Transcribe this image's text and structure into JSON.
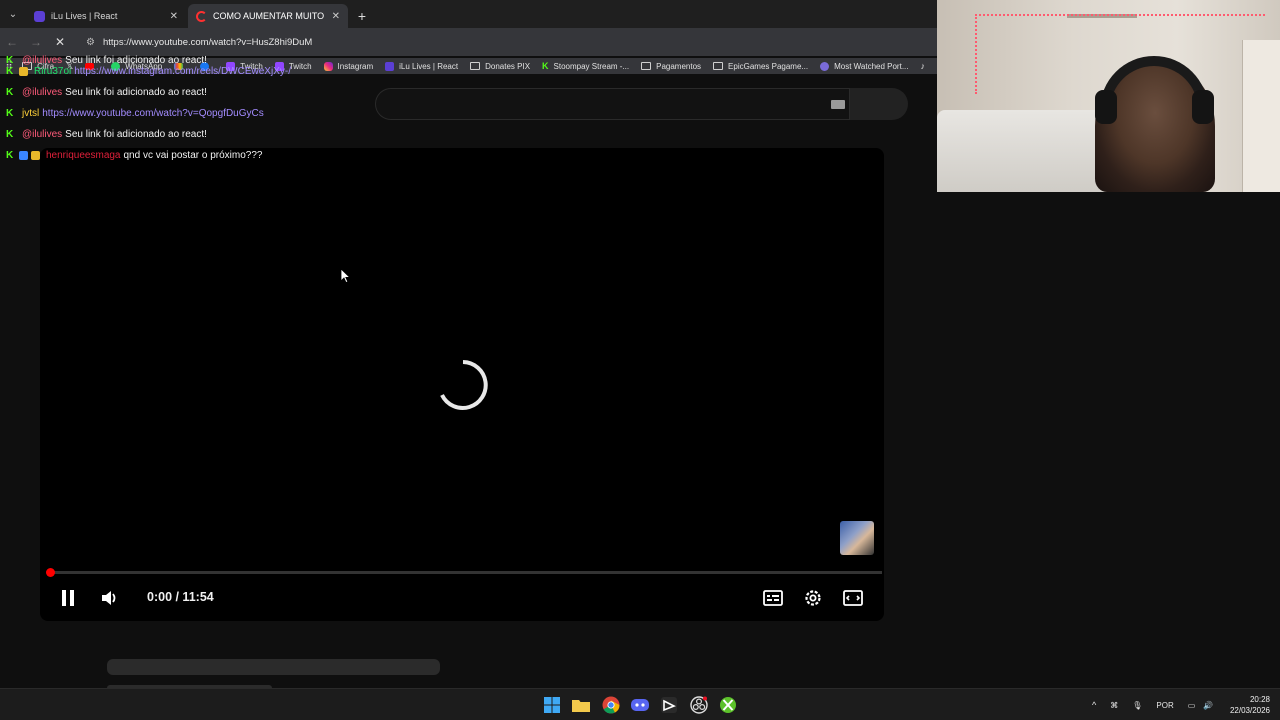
{
  "browser": {
    "tabs": [
      {
        "title": "iLu Lives | React",
        "close": "✕",
        "active": false,
        "favicon_color": "#5b3fd4"
      },
      {
        "title": "COMO AUMENTAR MUITO o FPS",
        "close": "✕",
        "active": true,
        "favicon_color": "#ff3030"
      }
    ],
    "new_tab": "+",
    "tab_menu": "⌄",
    "url": "https://www.youtube.com/watch?v=HusZ8hi9DuM",
    "bookmarks": [
      {
        "label": "Cifra",
        "icon": "folder-icon"
      },
      {
        "label": "",
        "icon": "x-icon"
      },
      {
        "label": "",
        "icon": "youtube-icon"
      },
      {
        "label": "WhatsApp",
        "icon": "whatsapp-icon"
      },
      {
        "label": "",
        "icon": "gmail-icon"
      },
      {
        "label": "",
        "icon": "facebook-icon"
      },
      {
        "label": "Twitch",
        "icon": "twitch-icon"
      },
      {
        "label": "Twitch",
        "icon": "twitch-icon"
      },
      {
        "label": "Instagram",
        "icon": "instagram-icon"
      },
      {
        "label": "iLu Lives | React",
        "icon": "ilu-icon"
      },
      {
        "label": "Donates PIX",
        "icon": "folder-icon"
      },
      {
        "label": "Stoompay Stream -...",
        "icon": "kick-icon"
      },
      {
        "label": "Pagamentos",
        "icon": "folder-icon"
      },
      {
        "label": "EpicGames Pagame...",
        "icon": "folder-icon"
      },
      {
        "label": "Most Watched Port...",
        "icon": "globe-icon"
      },
      {
        "label": "",
        "icon": "tiktok-icon"
      }
    ]
  },
  "chat": [
    {
      "badges": [
        "kick"
      ],
      "user": "@ilulives",
      "user_color": "#ff5b7a",
      "text": "Seu link foi adicionado ao react!",
      "is_link": false
    },
    {
      "badges": [
        "kick",
        "gold"
      ],
      "user": "Riru37oi",
      "user_color": "#1ee06a",
      "text": "https://www.instagram.com/reels/DWCEweXjXy-/",
      "is_link": true
    },
    {
      "badges": [
        "kick"
      ],
      "user": "@ilulives",
      "user_color": "#ff5b7a",
      "text": "Seu link foi adicionado ao react!",
      "is_link": false
    },
    {
      "badges": [
        "kick"
      ],
      "user": "jvtsl",
      "user_color": "#ffd23a",
      "text": "https://www.youtube.com/watch?v=QopgfDuGyCs",
      "is_link": true
    },
    {
      "badges": [
        "kick"
      ],
      "user": "@ilulives",
      "user_color": "#ff5b7a",
      "text": "Seu link foi adicionado ao react!",
      "is_link": false
    },
    {
      "badges": [
        "kick",
        "blue",
        "gold"
      ],
      "user": "henriqueesmaga",
      "user_color": "#e0203a",
      "text": "qnd vc vai postar o próximo???",
      "is_link": false
    }
  ],
  "player": {
    "time": "0:00 / 11:54",
    "progress_fraction": 0.0,
    "state": "loading",
    "controls": [
      "pause-icon",
      "volume-icon",
      "subtitles-icon",
      "settings-icon",
      "theater-icon"
    ]
  },
  "taskbar": {
    "apps": [
      "windows-start-icon",
      "file-explorer-icon",
      "chrome-icon",
      "discord-icon",
      "capcut-icon",
      "obs-icon",
      "xbox-icon"
    ],
    "tray": {
      "chevron": "^",
      "language": "POR",
      "time": "20:28",
      "date": "22/03/2026"
    }
  },
  "colors": {
    "accent_red": "#ff0000",
    "kick_green": "#53fc18",
    "link_purple": "#a38cff"
  }
}
